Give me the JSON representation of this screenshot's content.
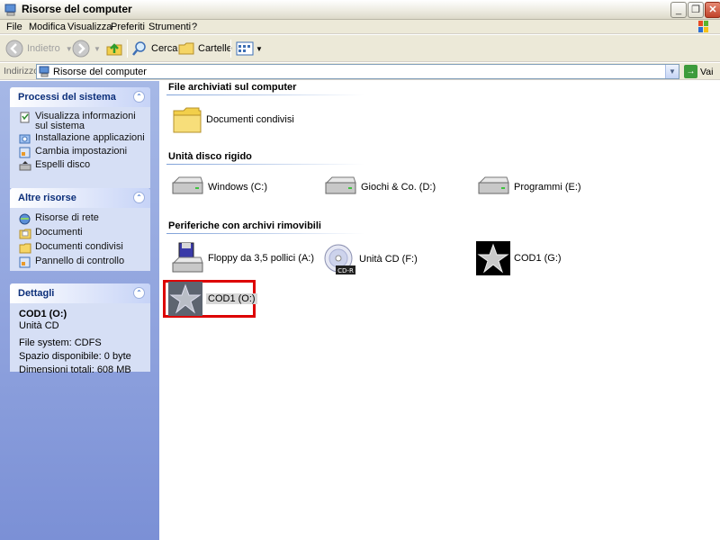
{
  "window": {
    "title": "Risorse del computer",
    "buttons": [
      "_",
      "❐",
      "✕"
    ]
  },
  "menu": [
    "File",
    "Modifica",
    "Visualizza",
    "Preferiti",
    "Strumenti",
    "?"
  ],
  "toolbar": {
    "back_label": "Indietro",
    "search_label": "Cerca",
    "folders_label": "Cartelle"
  },
  "address": {
    "label": "Indirizzo",
    "value": "Risorse del computer",
    "go_label": "Vai"
  },
  "left": {
    "system_tasks": {
      "title": "Processi del sistema",
      "items": [
        "Visualizza informazioni sul sistema",
        "Installazione applicazioni",
        "Cambia impostazioni",
        "Espelli disco"
      ]
    },
    "other_places": {
      "title": "Altre risorse",
      "items": [
        "Risorse di rete",
        "Documenti",
        "Documenti condivisi",
        "Pannello di controllo"
      ]
    },
    "details": {
      "title": "Dettagli",
      "name": "COD1 (O:)",
      "type": "Unità CD",
      "filesystem": "File system: CDFS",
      "free": "Spazio disponibile: 0 byte",
      "total": "Dimensioni totali: 608 MB"
    }
  },
  "main": {
    "sections": [
      {
        "title": "File archiviati sul computer",
        "items": [
          "Documenti condivisi"
        ]
      },
      {
        "title": "Unità disco rigido",
        "items": [
          "Windows (C:)",
          "Giochi & Co. (D:)",
          "Programmi (E:)"
        ]
      },
      {
        "title": "Periferiche con archivi rimovibili",
        "items": [
          "Floppy da 3,5 pollici (A:)",
          "Unità CD (F:)",
          "COD1 (G:)",
          "COD1 (O:)"
        ]
      }
    ],
    "cd_badge": "CD-R"
  }
}
